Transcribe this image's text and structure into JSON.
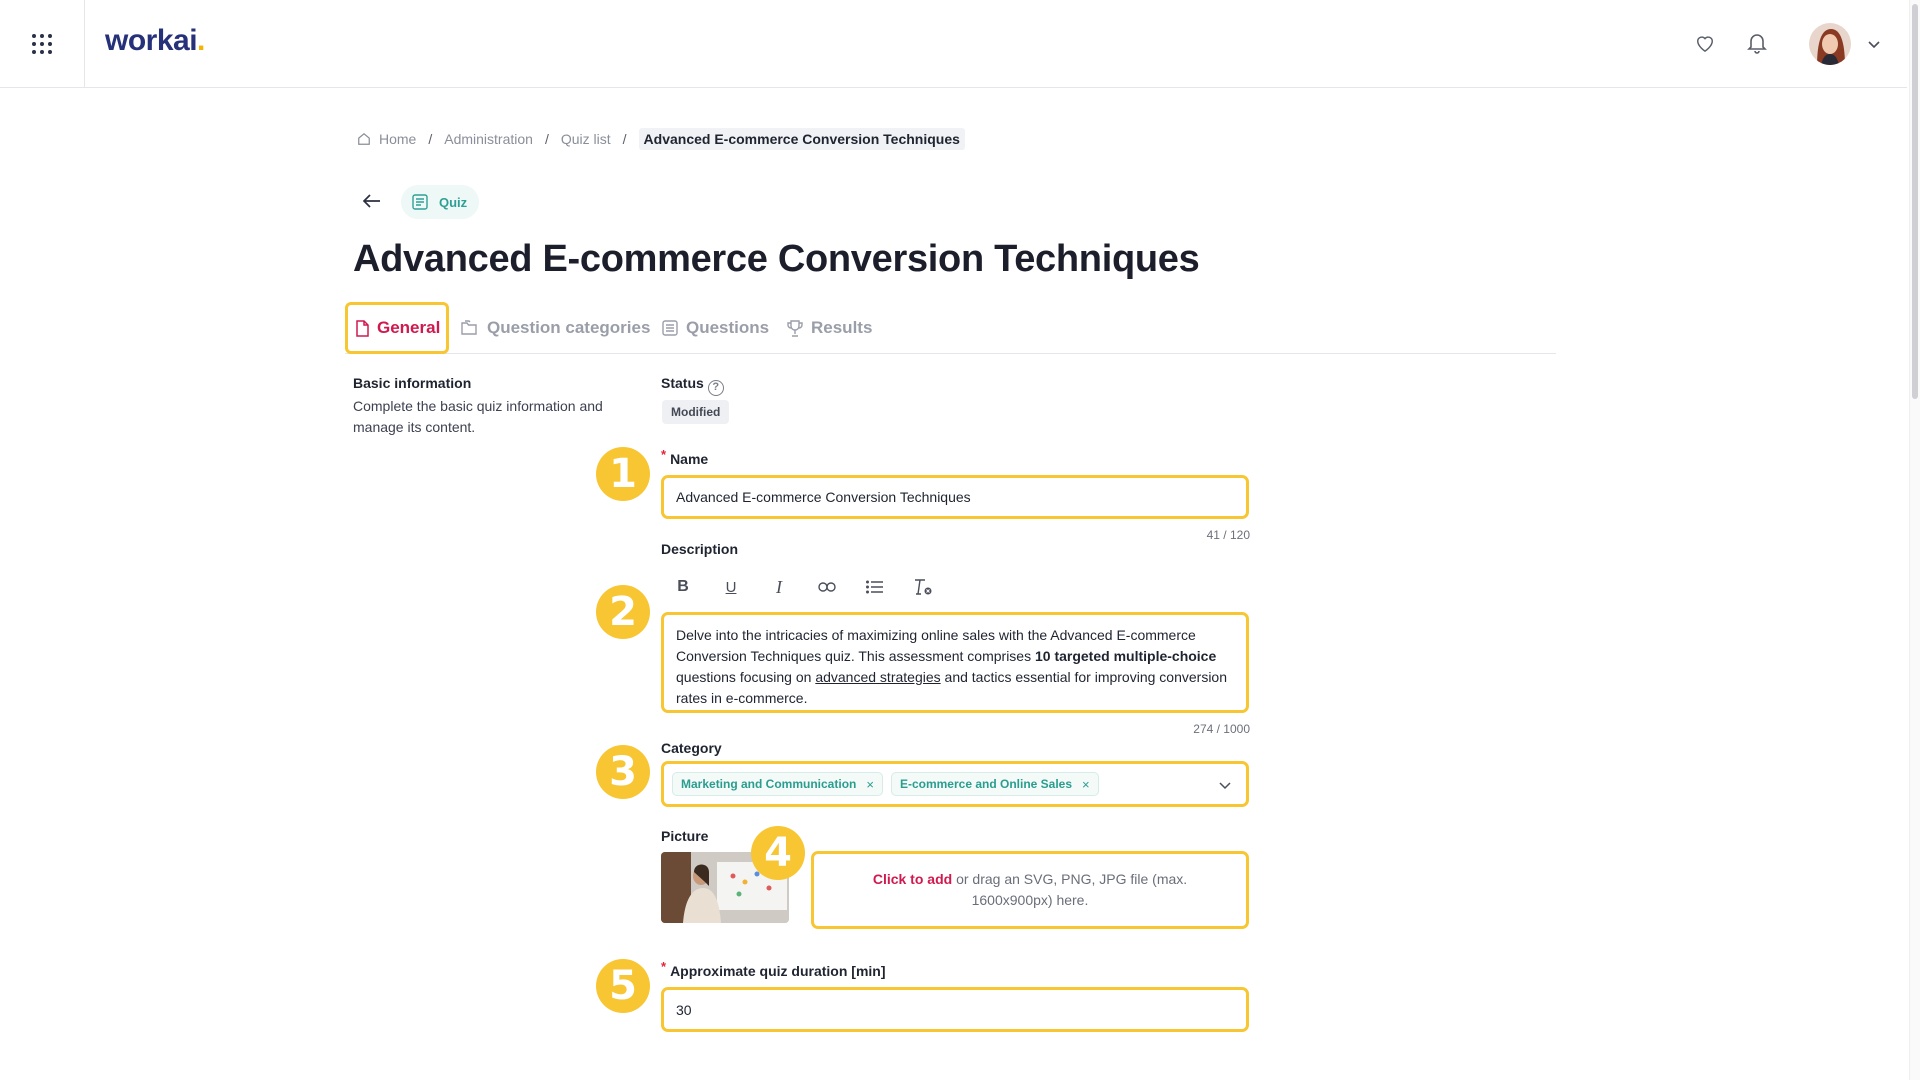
{
  "header": {
    "logo_text": "workai",
    "logo_dot": ".",
    "icons": [
      "apps-grid-icon",
      "heart-icon",
      "bell-icon",
      "chevron-down-icon"
    ]
  },
  "breadcrumb": {
    "home": "Home",
    "administration": "Administration",
    "quiz_list": "Quiz list",
    "current": "Advanced E-commerce Conversion Techniques",
    "separator": "/"
  },
  "badge": {
    "label": "Quiz"
  },
  "page_title": "Advanced E-commerce Conversion Techniques",
  "tabs": [
    {
      "label": "General",
      "active": true
    },
    {
      "label": "Question categories",
      "active": false
    },
    {
      "label": "Questions",
      "active": false
    },
    {
      "label": "Results",
      "active": false
    }
  ],
  "section": {
    "title": "Basic information",
    "description": "Complete the basic quiz information and manage its content."
  },
  "form": {
    "status_label": "Status",
    "status_value": "Modified",
    "name_label": "Name",
    "name_value": "Advanced E-commerce Conversion Techniques",
    "name_counter": "41 / 120",
    "description_label": "Description",
    "description": {
      "p1": "Delve into the intricacies of maximizing online sales with the Advanced E-commerce Conversion Techniques quiz. This assessment comprises ",
      "bold": "10 targeted multiple-choice",
      "p2": " questions focusing on ",
      "underline": "advanced strategies",
      "p3": " and tactics essential for improving conversion rates in e-commerce."
    },
    "description_counter": "274 / 1000",
    "category_label": "Category",
    "categories": [
      "Marketing and Communication",
      "E-commerce and Online Sales"
    ],
    "picture_label": "Picture",
    "upload_link": "Click to add",
    "upload_text": " or drag an SVG, PNG, JPG file (max. 1600x900px) here.",
    "duration_label": "Approximate quiz duration [min]",
    "duration_value": "30",
    "required_mark": "*"
  },
  "steps": [
    "1",
    "2",
    "3",
    "4",
    "5"
  ],
  "colors": {
    "accent": "#d0194f",
    "highlight": "#f7c632",
    "teal": "#2a9d8f",
    "brand": "#26317a"
  }
}
